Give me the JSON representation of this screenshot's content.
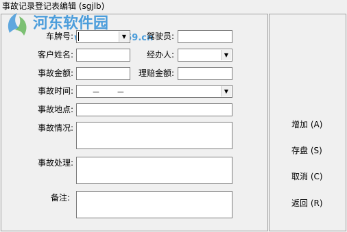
{
  "window": {
    "title": "事故记录登记表编辑 (sgjlb)"
  },
  "watermark": {
    "text": "河东软件园",
    "url": "www.pc0359.cn"
  },
  "form": {
    "plate_label": "车牌号:",
    "driver_label": "驾驶员:",
    "customer_label": "客户姓名:",
    "handler_label": "经办人:",
    "amount_label": "事故金额:",
    "claim_label": "理赔金额:",
    "time_label": "事故时间:",
    "time_value": "－ －",
    "place_label": "事故地点:",
    "situation_label": "事故情况:",
    "handling_label": "事故处理:",
    "remark_label": "备注:"
  },
  "buttons": {
    "add": "增加 (A)",
    "save": "存盘 (S)",
    "cancel": "取消 (C)",
    "back": "返回 (R)"
  },
  "icons": {
    "dropdown": "chevron-down-icon",
    "logo": "watermark-logo-icon"
  }
}
